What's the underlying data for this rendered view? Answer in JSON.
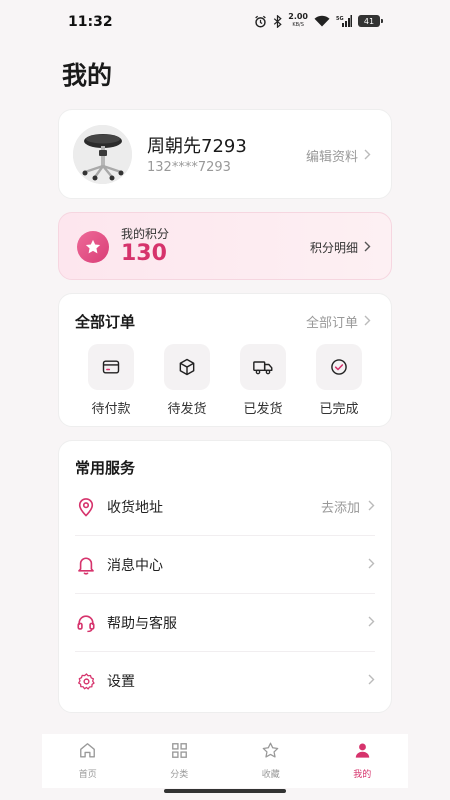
{
  "status_bar": {
    "time": "11:32",
    "net_speed": "2.00",
    "net_unit": "KB/S",
    "battery": "41",
    "signal_label": "5G"
  },
  "page": {
    "title": "我的"
  },
  "profile": {
    "nickname": "周朝先7293",
    "phone": "132****7293",
    "edit_label": "编辑资料"
  },
  "points": {
    "label": "我的积分",
    "value": "130",
    "detail_label": "积分明细"
  },
  "orders": {
    "title": "全部订单",
    "all_label": "全部订单",
    "items": [
      {
        "label": "待付款",
        "icon": "wallet-icon"
      },
      {
        "label": "待发货",
        "icon": "package-icon"
      },
      {
        "label": "已发货",
        "icon": "truck-icon"
      },
      {
        "label": "已完成",
        "icon": "check-circle-icon"
      }
    ]
  },
  "services": {
    "title": "常用服务",
    "items": [
      {
        "label": "收货地址",
        "extra": "去添加",
        "icon": "location-pin-icon"
      },
      {
        "label": "消息中心",
        "extra": "",
        "icon": "bell-icon"
      },
      {
        "label": "帮助与客服",
        "extra": "",
        "icon": "headset-icon"
      },
      {
        "label": "设置",
        "extra": "",
        "icon": "gear-icon"
      }
    ]
  },
  "tabbar": {
    "items": [
      {
        "label": "首页",
        "icon": "home-icon",
        "active": false
      },
      {
        "label": "分类",
        "icon": "grid-icon",
        "active": false
      },
      {
        "label": "收藏",
        "icon": "star-icon",
        "active": false
      },
      {
        "label": "我的",
        "icon": "user-icon",
        "active": true
      }
    ]
  },
  "colors": {
    "accent": "#d6336c",
    "background": "#f8f5f6",
    "points_bg": "#fde6ee"
  }
}
